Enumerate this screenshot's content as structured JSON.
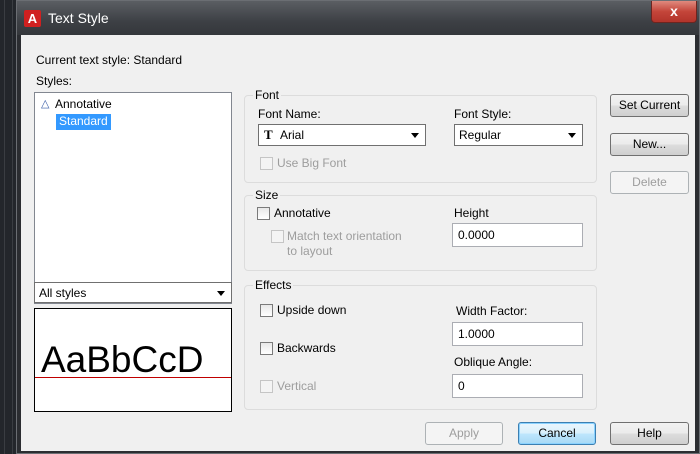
{
  "window": {
    "title": "Text Style",
    "close_label": "x"
  },
  "current_style": {
    "label": "Current text style:",
    "value": "Standard"
  },
  "styles": {
    "label": "Styles:",
    "items": [
      {
        "label": "Annotative",
        "icon": "annotative-icon",
        "selected": false
      },
      {
        "label": "Standard",
        "selected": true
      }
    ],
    "filter_value": "All styles"
  },
  "preview": {
    "text": "AaBbCcD"
  },
  "font": {
    "group_label": "Font",
    "name_label": "Font Name:",
    "name_value": "Arial",
    "font_icon": "truetype-font-icon",
    "style_label": "Font Style:",
    "style_value": "Regular",
    "big_font_label": "Use Big Font"
  },
  "size": {
    "group_label": "Size",
    "annotative_label": "Annotative",
    "match_label_line1": "Match text orientation",
    "match_label_line2": "to layout",
    "height_label": "Height",
    "height_value": "0.0000"
  },
  "effects": {
    "group_label": "Effects",
    "upside_down_label": "Upside down",
    "backwards_label": "Backwards",
    "vertical_label": "Vertical",
    "width_factor_label": "Width Factor:",
    "width_factor_value": "1.0000",
    "oblique_label": "Oblique Angle:",
    "oblique_value": "0"
  },
  "buttons": {
    "set_current": "Set Current",
    "new": "New...",
    "delete": "Delete",
    "apply": "Apply",
    "cancel": "Cancel",
    "help": "Help"
  },
  "colors": {
    "selection": "#3399ff",
    "title_gradient_top": "#5b5e63",
    "close_red": "#c4453a"
  }
}
